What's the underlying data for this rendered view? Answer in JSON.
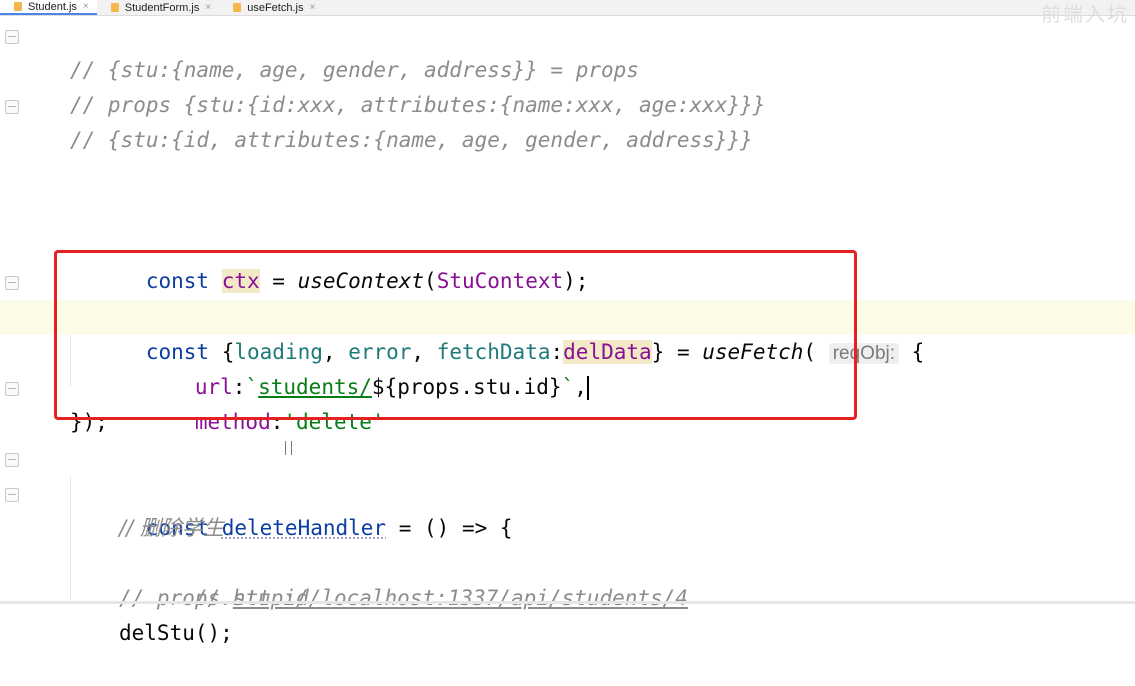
{
  "tabs": [
    {
      "label": "Student.js",
      "active": true
    },
    {
      "label": "StudentForm.js",
      "active": false
    },
    {
      "label": "useFetch.js",
      "active": false
    }
  ],
  "tab_close_glyph": "×",
  "watermark": "前端入坑",
  "code": {
    "l1": "// {stu:{name, age, gender, address}} = props",
    "l2": "// props {stu:{id:xxx, attributes:{name:xxx, age:xxx}}}",
    "l3": "// {stu:{id, attributes:{name, age, gender, address}}}",
    "ctx_kw": "const ",
    "ctx_var": "ctx",
    "ctx_eq": " = ",
    "ctx_fn": "useContext",
    "ctx_open": "(",
    "ctx_cls": "StuContext",
    "ctx_close": ");",
    "fetch_kw": "const ",
    "fetch_open": "{",
    "fetch_loading": "loading",
    "fetch_comma1": ", ",
    "fetch_error": "error",
    "fetch_comma2": ", ",
    "fetch_fetchData": "fetchData",
    "fetch_colon": ":",
    "fetch_delData": "delData",
    "fetch_close": "} = ",
    "fetch_fn": "useFetch",
    "fetch_paren": "( ",
    "fetch_hint": "reqObj:",
    "fetch_brace": " {",
    "url_key": "url",
    "url_colon": ":",
    "url_tick": "`",
    "url_str": "students/",
    "url_tpl_open": "${",
    "url_tpl_expr": "props.stu.id",
    "url_tpl_close": "}",
    "url_tick2": "`",
    "url_comma": ",",
    "method_key": "method",
    "method_colon": ":",
    "method_val": "'delete'",
    "close_call": "});",
    "del_kw": "const ",
    "del_name": "deleteHandler",
    "del_rest": " = () => {",
    "c1": "// 删除学生",
    "c2_prefix": "// ",
    "c2_link": "http://localhost:1337/api/students/4",
    "c3": "// props.stu.id",
    "last": "delStu();"
  }
}
